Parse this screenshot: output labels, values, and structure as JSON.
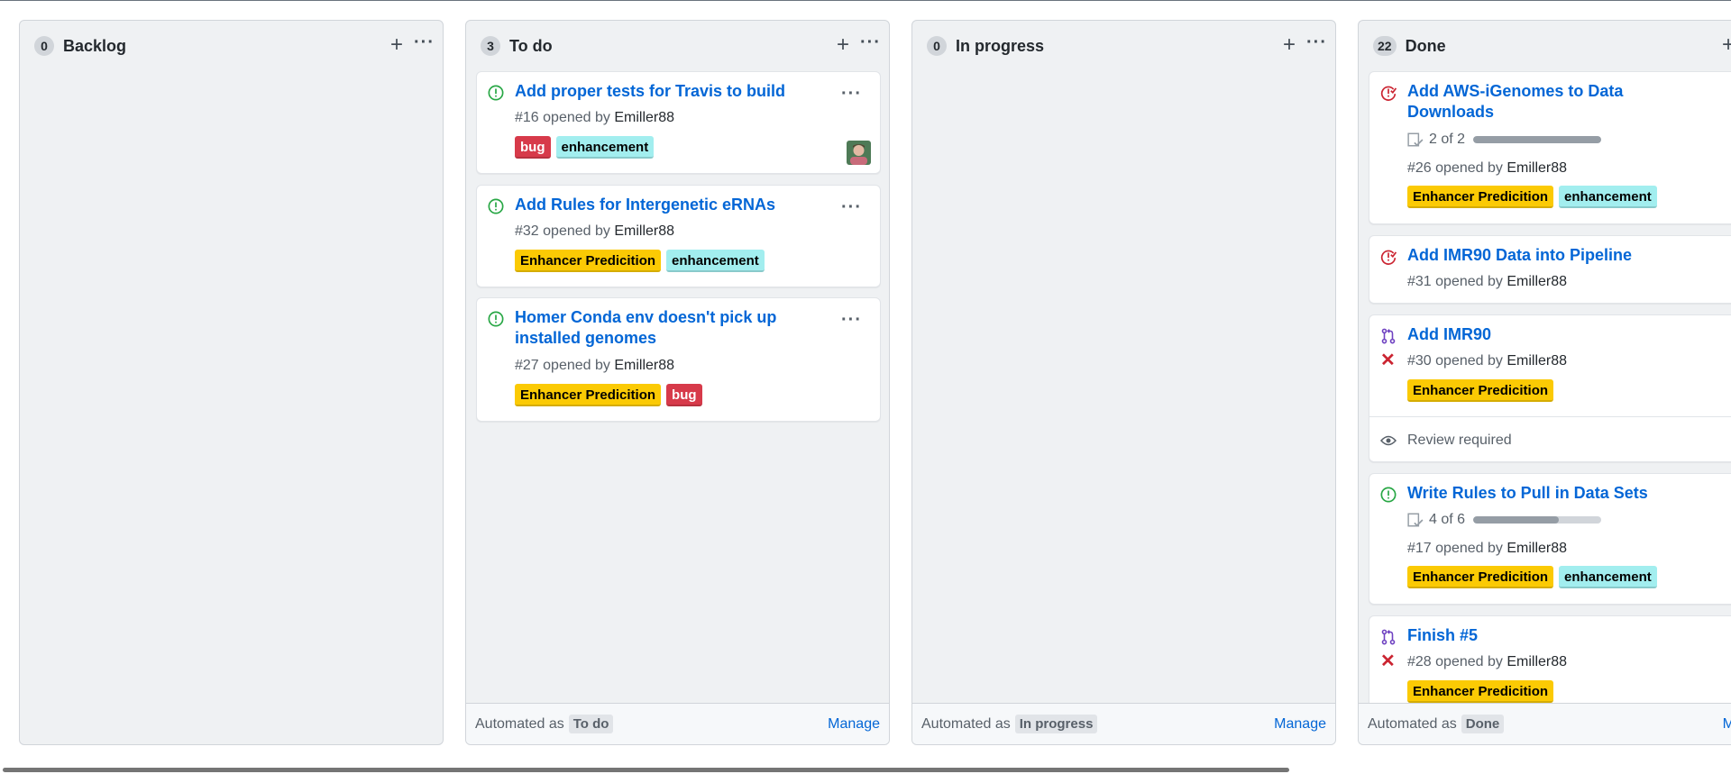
{
  "columns": [
    {
      "count": "0",
      "title": "Backlog"
    },
    {
      "count": "3",
      "title": "To do",
      "automated_as_label": "Automated as",
      "automated_as": "To do",
      "manage": "Manage"
    },
    {
      "count": "0",
      "title": "In progress",
      "automated_as_label": "Automated as",
      "automated_as": "In progress",
      "manage": "Manage"
    },
    {
      "count": "22",
      "title": "Done",
      "automated_as_label": "Automated as",
      "automated_as": "Done",
      "manage": "M"
    }
  ],
  "todo_cards": [
    {
      "title": "Add proper tests for Travis to build",
      "number": "#16",
      "opened_by": "opened by",
      "author": "Emiller88",
      "labels": [
        "bug",
        "enhancement"
      ],
      "icon": "issue-open-icon"
    },
    {
      "title": "Add Rules for Intergenetic eRNAs",
      "number": "#32",
      "opened_by": "opened by",
      "author": "Emiller88",
      "labels": [
        "Enhancer Predicition",
        "enhancement"
      ],
      "icon": "issue-open-icon"
    },
    {
      "title": "Homer Conda env doesn't pick up installed genomes",
      "title_line1": "Homer Conda env doesn't pick up",
      "title_line2": "installed genomes",
      "number": "#27",
      "opened_by": "opened by",
      "author": "Emiller88",
      "labels": [
        "Enhancer Predicition",
        "bug"
      ],
      "icon": "issue-open-icon"
    }
  ],
  "done_cards": [
    {
      "title_line1": "Add AWS-iGenomes to Data",
      "title_line2": "Downloads",
      "progress": "2 of 2",
      "progress_fraction": 1.0,
      "number": "#26",
      "opened_by": "opened by",
      "author": "Emiller88",
      "labels": [
        "Enhancer Predicition",
        "enhancement"
      ],
      "icon": "issue-closed-icon"
    },
    {
      "title": "Add IMR90 Data into Pipeline",
      "number": "#31",
      "opened_by": "opened by",
      "author": "Emiller88",
      "icon": "issue-closed-icon"
    },
    {
      "title": "Add IMR90",
      "number": "#30",
      "opened_by": "opened by",
      "author": "Emiller88",
      "labels": [
        "Enhancer Predicition"
      ],
      "review": "Review required",
      "icon": "pull-request-icon"
    },
    {
      "title": "Write Rules to Pull in Data Sets",
      "progress": "4 of 6",
      "progress_fraction": 0.6667,
      "number": "#17",
      "opened_by": "opened by",
      "author": "Emiller88",
      "labels": [
        "Enhancer Predicition",
        "enhancement"
      ],
      "icon": "issue-open-icon"
    },
    {
      "title": "Finish #5",
      "number": "#28",
      "opened_by": "opened by",
      "author": "Emiller88",
      "labels": [
        "Enhancer Predicition"
      ],
      "icon": "pull-request-icon"
    }
  ],
  "label_colors": {
    "bug": {
      "bg": "#d73a4a",
      "fg": "#ffffff"
    },
    "enhancement": {
      "bg": "#a2eeef",
      "fg": "#000000"
    },
    "Enhancer Predicition": {
      "bg": "#fbca04",
      "fg": "#000000"
    }
  },
  "colors": {
    "link": "#0366d6",
    "open": "#28a745",
    "closed": "#cb2431",
    "pr": "#6f42c1"
  }
}
